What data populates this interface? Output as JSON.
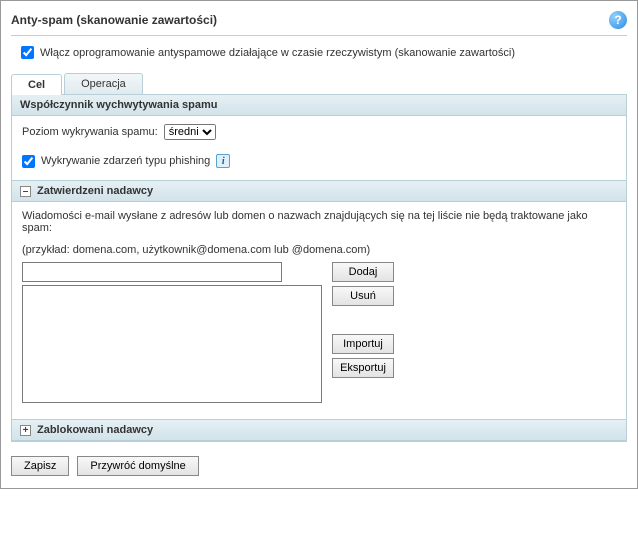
{
  "header": {
    "title": "Anty-spam (skanowanie zawartości)",
    "help_symbol": "?"
  },
  "enable": {
    "label": "Włącz oprogramowanie antyspamowe działające w czasie rzeczywistym (skanowanie zawartości)",
    "checked": true
  },
  "tabs": [
    {
      "label": "Cel",
      "active": true
    },
    {
      "label": "Operacja",
      "active": false
    }
  ],
  "catch_rate": {
    "header": "Współczynnik wychwytywania spamu",
    "level_label": "Poziom wykrywania spamu:",
    "level_value": "średni",
    "phishing_label": "Wykrywanie zdarzeń typu phishing",
    "phishing_checked": true,
    "info_symbol": "i"
  },
  "approved": {
    "expander": "–",
    "header": "Zatwierdzeni nadawcy",
    "desc": "Wiadomości e-mail wysłane z adresów lub domen o nazwach znajdujących się na tej liście nie będą traktowane jako spam:",
    "example": "(przykład: domena.com, użytkownik@domena.com lub @domena.com)",
    "buttons": {
      "add": "Dodaj",
      "remove": "Usuń",
      "import": "Importuj",
      "export": "Eksportuj"
    }
  },
  "blocked": {
    "expander": "+",
    "header": "Zablokowani nadawcy"
  },
  "footer": {
    "save": "Zapisz",
    "restore": "Przywróć domyślne"
  }
}
